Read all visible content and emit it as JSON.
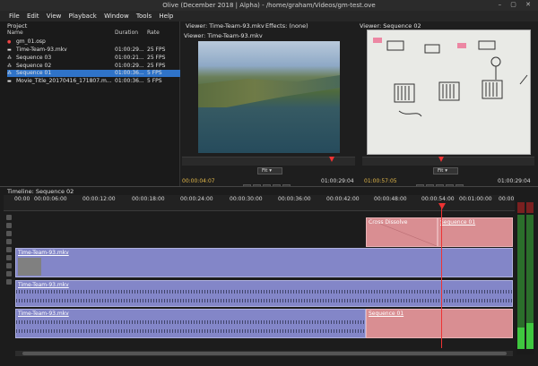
{
  "window": {
    "title": "Olive (December 2018 | Alpha) - /home/graham/Videos/gm-test.ove",
    "controls": "– ▢ ✕"
  },
  "menu": [
    "File",
    "Edit",
    "View",
    "Playback",
    "Window",
    "Tools",
    "Help"
  ],
  "project": {
    "title": "Project",
    "columns": {
      "name": "Name",
      "duration": "Duration",
      "rate": "Rate"
    },
    "items": [
      {
        "name": "gm_01.osp",
        "duration": "",
        "rate": "",
        "icon": "audio-icon",
        "selected": false
      },
      {
        "name": "Time-Team-93.mkv",
        "duration": "01:00:29...",
        "rate": "25 FPS",
        "icon": "video-icon",
        "selected": false
      },
      {
        "name": "Sequence 03",
        "duration": "01:00:21...",
        "rate": "25 FPS",
        "icon": "sequence-icon",
        "selected": false
      },
      {
        "name": "Sequence 02",
        "duration": "01:00:29...",
        "rate": "25 FPS",
        "icon": "sequence-icon",
        "selected": false
      },
      {
        "name": "Sequence 01",
        "duration": "01:00:36...",
        "rate": "5 FPS",
        "icon": "sequence-icon",
        "selected": true
      },
      {
        "name": "Movie_Title_20170416_171807.m...",
        "duration": "01:00:36...",
        "rate": "5 FPS",
        "icon": "video-icon",
        "selected": false
      }
    ]
  },
  "viewer1": {
    "tab_viewer": "Viewer: Time-Team-93.mkv",
    "tab_effects": "Effects: (none)",
    "title": "Viewer: Time-Team-93.mkv",
    "fit": "Fit",
    "tc_left": "00:00:04:07",
    "tc_right": "01:00:29:04"
  },
  "viewer2": {
    "title": "Viewer: Sequence 02",
    "fit": "Fit",
    "tc_left": "01:00:57:05",
    "tc_right": "01:00:29:04"
  },
  "timeline": {
    "title": "Timeline: Sequence 02",
    "ticks": [
      "00:00",
      "00:00:06:00",
      "00:00:12:00",
      "00:00:18:00",
      "00:00:24:00",
      "00:00:30:00",
      "00:00:36:00",
      "00:00:42:00",
      "00:00:48:00",
      "00:00:54:00",
      "00:01:00:00",
      "00:00"
    ],
    "clips": {
      "transition": "Cross Dissolve",
      "seq1_top": "Sequence 01",
      "video_main": "Time-Team-93.mkv",
      "audio1": "Time-Team-93.mkv",
      "audio2": "Time-Team-93.mkv",
      "seq1_bottom": "Sequence 01"
    }
  }
}
